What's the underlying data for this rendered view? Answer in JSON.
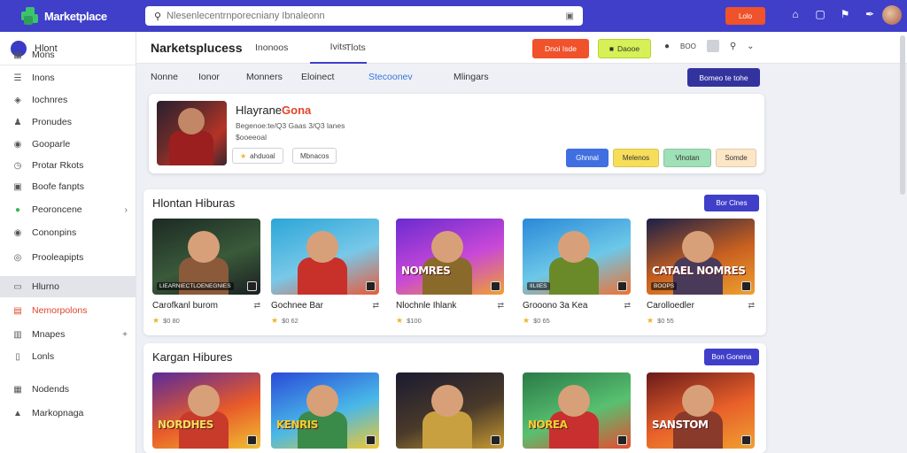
{
  "topbar": {
    "brand": "Marketplace",
    "search_placeholder": "Nlesenlecentrnporecniany Ibnaleonn",
    "cta_label": "Lolo",
    "icons": [
      "home-icon",
      "chat-icon",
      "flag-icon",
      "settings-icon"
    ]
  },
  "sidebar": {
    "header": "Hlont",
    "items": [
      {
        "label": "Mons",
        "icon": "grid-icon"
      },
      {
        "label": "Inons",
        "icon": "list-icon"
      },
      {
        "label": "Iochnres",
        "icon": "shield-icon"
      },
      {
        "label": "Pronudes",
        "icon": "people-icon"
      },
      {
        "label": "Gooparle",
        "icon": "chat-icon"
      },
      {
        "label": "Protar Rkots",
        "icon": "clock-icon"
      },
      {
        "label": "Boofe fanpts",
        "icon": "image-icon"
      },
      {
        "label": "Peoroncene",
        "icon": "circle-icon",
        "chevron": "›"
      },
      {
        "label": "Cononpins",
        "icon": "chat-icon"
      },
      {
        "label": "Prooleapipts",
        "icon": "location-icon"
      },
      {
        "label": "Hlurno",
        "icon": "card-icon",
        "active": true
      },
      {
        "label": "Nemorpolons",
        "icon": "hot-icon",
        "hot": true
      },
      {
        "label": "Mnapes",
        "icon": "box-icon",
        "chevron": "+"
      },
      {
        "label": "Lonls",
        "icon": "doc-icon"
      },
      {
        "label": "Nodends",
        "icon": "grid-icon"
      },
      {
        "label": "Markopnaga",
        "icon": "mountain-icon"
      }
    ]
  },
  "header": {
    "title": "Narketsplucess",
    "tabs": [
      {
        "label": "Inonoos"
      },
      {
        "label": "Ivits",
        "active": true
      },
      {
        "label": "Tlots"
      }
    ],
    "orange_button": "Dnoi Isde",
    "yellow_button": "Daooe",
    "status_text": "BOO"
  },
  "filters": {
    "tabs": [
      "Nonne",
      "Ionor",
      "Monners",
      "Eloinect",
      "Stecoonev",
      "Mlingars"
    ],
    "action_button": "Bomeo te tohe"
  },
  "featured": {
    "title": "Hlayrane",
    "title_accent": "Gona",
    "subtitle": "Begenoe:te/Q3 Gaas 3/Q3 lanes",
    "price": "$ooeeoal",
    "chip1": "ahduoal",
    "chip2": "Mbnacos",
    "buttons": [
      {
        "label": "Ghnnal",
        "bg": "#3f6fe0",
        "fg": "#ffffff"
      },
      {
        "label": "Melenos",
        "bg": "#f7de5a",
        "fg": "#333333"
      },
      {
        "label": "Vlnotan",
        "bg": "#9fe0b6",
        "fg": "#333333"
      },
      {
        "label": "Somde",
        "bg": "#fde6c6",
        "fg": "#333333"
      }
    ]
  },
  "sections": [
    {
      "title": "Hlontan Hiburas",
      "button": "Bor Clnes",
      "cards": [
        {
          "name": "Carofkanl burom",
          "price": "$0 80",
          "overlay": "",
          "tag": "LIEARNIECTLOENEGNIES"
        },
        {
          "name": "Gochnee Bar",
          "price": "$0 62",
          "overlay": "",
          "tag": ""
        },
        {
          "name": "Nlochnle Ihlank",
          "price": "$100",
          "overlay": "NOMRES",
          "tag": ""
        },
        {
          "name": "Grooono 3a Kea",
          "price": "$0 65",
          "overlay": "",
          "tag": "IILIIES"
        },
        {
          "name": "Carolloedler",
          "price": "$0 55",
          "overlay": "CATAEL NOMRES",
          "tag": "BOOPS"
        }
      ]
    },
    {
      "title": "Kargan Hibures",
      "button": "Bon Gonena",
      "cards": [
        {
          "name": "",
          "price": "",
          "overlay": "NORDHES",
          "tag": ""
        },
        {
          "name": "",
          "price": "",
          "overlay": "KENRIS",
          "tag": ""
        },
        {
          "name": "",
          "price": "",
          "overlay": "",
          "tag": ""
        },
        {
          "name": "",
          "price": "",
          "overlay": "NOREA",
          "tag": ""
        },
        {
          "name": "",
          "price": "",
          "overlay": "SANSTOM",
          "tag": ""
        }
      ]
    }
  ]
}
